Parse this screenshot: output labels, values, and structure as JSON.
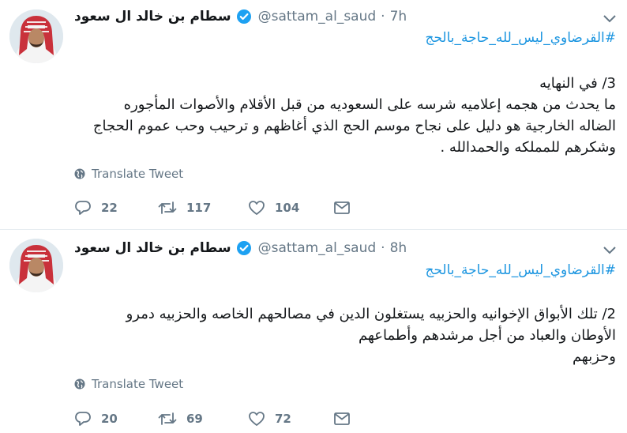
{
  "colors": {
    "link": "#1b95e0",
    "muted": "#657786",
    "text": "#14171a",
    "verified": "#1da1f2"
  },
  "tweets": [
    {
      "author_name": "سطام بن خالد ال سعود",
      "handle": "@sattam_al_saud",
      "time": "7h",
      "hashtag": "#القرضاوي_ليس_لله_حاجة_بالحج",
      "body_lines": [
        "3/ في النهايه",
        "ما يحدث من هجمه إعلاميه شرسه على السعوديه من قبل الأقلام والأصوات المأجوره",
        "الضاله الخارجية هو دليل على نجاح موسم الحج الذي أغاظهم و ترحيب وحب عموم الحجاج",
        "وشكرهم للمملكه والحمدالله ."
      ],
      "translate_label": "Translate Tweet",
      "replies": "22",
      "retweets": "117",
      "likes": "104"
    },
    {
      "author_name": "سطام بن خالد ال سعود",
      "handle": "@sattam_al_saud",
      "time": "8h",
      "hashtag": "#القرضاوي_ليس_لله_حاجة_بالحج",
      "body_lines": [
        "2/ تلك الأبواق الإخوانيه والحزبيه يستغلون الدين في مصالحهم الخاصه والحزبيه دمرو",
        "الأوطان والعباد من أجل مرشدهم وأطماعهم",
        "وحزبهم"
      ],
      "translate_label": "Translate Tweet",
      "replies": "20",
      "retweets": "69",
      "likes": "72"
    }
  ]
}
